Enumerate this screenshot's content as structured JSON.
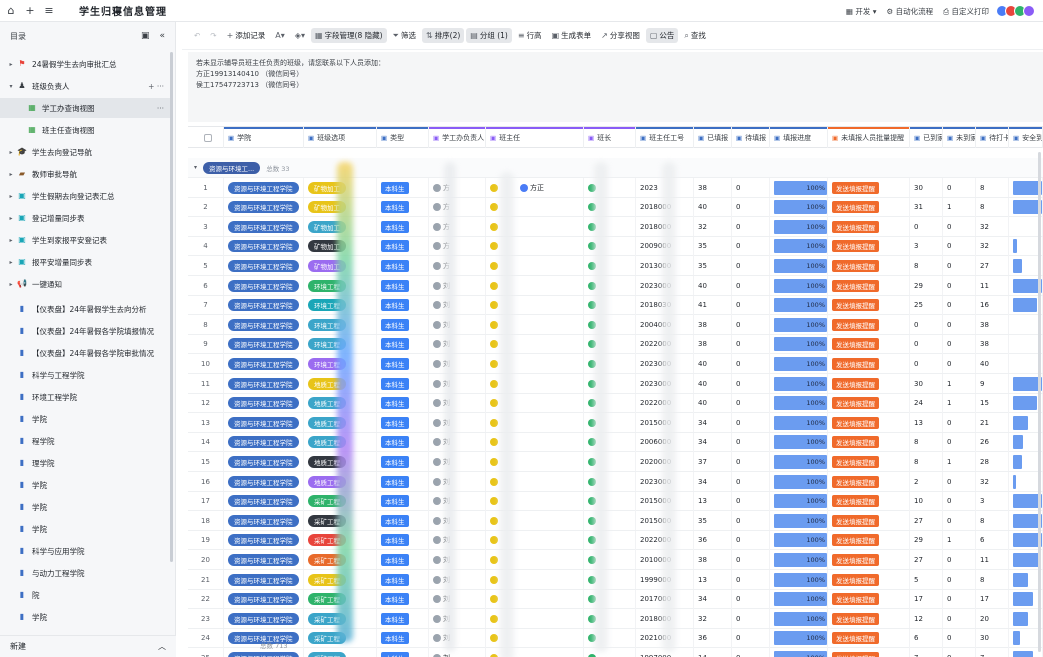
{
  "topbar": {
    "title": "学生归寝信息管理",
    "right_items": [
      "开发",
      "自动化流程",
      "自定义打印"
    ]
  },
  "sidebar": {
    "heading": "目录",
    "footer_new": "新建",
    "items": [
      {
        "label": "24暑假学生去向审批汇总",
        "icon": "flag-icon",
        "icon_color": "#e8453c",
        "arrow": "right"
      },
      {
        "label": "班级负责人",
        "icon": "person-icon",
        "icon_color": "#3a3f45",
        "arrow": "down"
      },
      {
        "label": "学工办查询视图",
        "icon": "table-icon",
        "icon_color": "#2e9c3f",
        "arrow": "",
        "selected": true
      },
      {
        "label": "班主任查询视图",
        "icon": "table-icon",
        "icon_color": "#2e9c3f",
        "arrow": ""
      },
      {
        "label": "学生去向登记导航",
        "icon": "cap-icon",
        "icon_color": "#3a3f45",
        "arrow": "right"
      },
      {
        "label": "教师审批导航",
        "icon": "briefcase-icon",
        "icon_color": "#8a5a2b",
        "arrow": "right"
      },
      {
        "label": "学生假期去向登记表汇总",
        "icon": "form-icon",
        "icon_color": "#1aa6b7",
        "arrow": "right"
      },
      {
        "label": "登记增量同步表",
        "icon": "form-icon",
        "icon_color": "#1aa6b7",
        "arrow": "right"
      },
      {
        "label": "学生到家报平安登记表",
        "icon": "form-icon",
        "icon_color": "#1aa6b7",
        "arrow": "right"
      },
      {
        "label": "报平安增量同步表",
        "icon": "form-icon",
        "icon_color": "#1aa6b7",
        "arrow": "right"
      },
      {
        "label": "一键通知",
        "icon": "megaphone-icon",
        "icon_color": "#e8453c",
        "arrow": "right"
      },
      {
        "label": "【仪表盘】24年暑假学生去向分析",
        "icon": "dashboard-icon",
        "icon_color": "#3d6fc4",
        "arrow": ""
      },
      {
        "label": "【仪表盘】24年暑假各学院填报情况",
        "icon": "dashboard-icon",
        "icon_color": "#3d6fc4",
        "arrow": ""
      },
      {
        "label": "【仪表盘】24年暑假各学院审批情况",
        "icon": "dashboard-icon",
        "icon_color": "#3d6fc4",
        "arrow": ""
      },
      {
        "label": "科学与工程学院",
        "icon": "dashboard-icon",
        "icon_color": "#3d6fc4",
        "arrow": ""
      },
      {
        "label": "环境工程学院",
        "icon": "dashboard-icon",
        "icon_color": "#3d6fc4",
        "arrow": ""
      },
      {
        "label": "学院",
        "icon": "dashboard-icon",
        "icon_color": "#3d6fc4",
        "arrow": ""
      },
      {
        "label": "程学院",
        "icon": "dashboard-icon",
        "icon_color": "#3d6fc4",
        "arrow": ""
      },
      {
        "label": "理学院",
        "icon": "dashboard-icon",
        "icon_color": "#3d6fc4",
        "arrow": ""
      },
      {
        "label": "学院",
        "icon": "dashboard-icon",
        "icon_color": "#3d6fc4",
        "arrow": ""
      },
      {
        "label": "学院",
        "icon": "dashboard-icon",
        "icon_color": "#3d6fc4",
        "arrow": ""
      },
      {
        "label": "学院",
        "icon": "dashboard-icon",
        "icon_color": "#3d6fc4",
        "arrow": ""
      },
      {
        "label": "科学与应用学院",
        "icon": "dashboard-icon",
        "icon_color": "#3d6fc4",
        "arrow": ""
      },
      {
        "label": "与动力工程学院",
        "icon": "dashboard-icon",
        "icon_color": "#3d6fc4",
        "arrow": ""
      },
      {
        "label": "院",
        "icon": "dashboard-icon",
        "icon_color": "#3d6fc4",
        "arrow": ""
      },
      {
        "label": "学院",
        "icon": "dashboard-icon",
        "icon_color": "#3d6fc4",
        "arrow": ""
      }
    ]
  },
  "toolbar": {
    "items": [
      {
        "label": "添加记录",
        "glyph": "+"
      },
      {
        "label": "",
        "glyph": "A▾"
      },
      {
        "label": "",
        "glyph": "◈▾"
      },
      {
        "label": "字段管理(8 隐藏)",
        "glyph": "▦",
        "on": true
      },
      {
        "label": "筛选",
        "glyph": "⏷"
      },
      {
        "label": "排序(2)",
        "glyph": "⇅",
        "on": true
      },
      {
        "label": "分组 (1)",
        "glyph": "▤",
        "on": true
      },
      {
        "label": "行高",
        "glyph": "≡"
      },
      {
        "label": "生成表单",
        "glyph": "▣"
      },
      {
        "label": "分享视图",
        "glyph": "↗"
      },
      {
        "label": "公告",
        "glyph": "▢",
        "on": true
      },
      {
        "label": "查找",
        "glyph": "⌕"
      }
    ]
  },
  "notice": {
    "lines": [
      "若未显示辅导员班主任负责的班级，请您联系以下人员添加：",
      "方正19913140410 （微信同号）",
      "侯工17547723713 （微信同号）"
    ]
  },
  "columns": [
    {
      "label": "学院",
      "color": "#3d6fc4"
    },
    {
      "label": "班级选项",
      "color": "#3d6fc4"
    },
    {
      "label": "类型",
      "color": "#3d6fc4"
    },
    {
      "label": "学工办负责人",
      "color": "#8a5cf6"
    },
    {
      "label": "班主任",
      "color": "#8a5cf6"
    },
    {
      "label": "班长",
      "color": "#8a5cf6"
    },
    {
      "label": "班主任工号",
      "color": "#3d6fc4"
    },
    {
      "label": "已填报",
      "color": "#3d6fc4"
    },
    {
      "label": "待填报",
      "color": "#3d6fc4"
    },
    {
      "label": "填报进度",
      "color": "#3d6fc4"
    },
    {
      "label": "未填报人员批量提醒",
      "color": "#f06a2b"
    },
    {
      "label": "已到家",
      "color": "#3d6fc4"
    },
    {
      "label": "未到家",
      "color": "#3d6fc4"
    },
    {
      "label": "待打卡",
      "color": "#3d6fc4"
    },
    {
      "label": "安全到家",
      "color": "#3d6fc4"
    }
  ],
  "group": {
    "chip": "资源与环境工...",
    "count_label": "总数",
    "count": "33"
  },
  "rows": [
    {
      "n": "1",
      "school": "资源与环境工程学院",
      "cls": "矿物加工",
      "cls_color": "#e8c419",
      "type": "本科生",
      "head": "方",
      "teacher": "方正",
      "no": "2023",
      "filled": "38",
      "pending": "0",
      "progress": "100%",
      "remind": "发送填报提醒",
      "home": "30",
      "away": "0",
      "punch": "8",
      "safe": 0.79
    },
    {
      "n": "2",
      "school": "资源与环境工程学院",
      "cls": "矿物加工",
      "cls_color": "#e8c419",
      "type": "本科生",
      "head": "方",
      "teacher": "",
      "no": "2018000",
      "filled": "40",
      "pending": "0",
      "progress": "100%",
      "remind": "发送填报提醒",
      "home": "31",
      "away": "1",
      "punch": "8",
      "safe": 0.78
    },
    {
      "n": "3",
      "school": "资源与环境工程学院",
      "cls": "矿物加工",
      "cls_color": "#3ba5c9",
      "type": "本科生",
      "head": "方",
      "teacher": "",
      "no": "2018000",
      "filled": "32",
      "pending": "0",
      "progress": "100%",
      "remind": "发送填报提醒",
      "home": "0",
      "away": "0",
      "punch": "32",
      "safe": 0
    },
    {
      "n": "4",
      "school": "资源与环境工程学院",
      "cls": "矿物加工",
      "cls_color": "#333840",
      "type": "本科生",
      "head": "方",
      "teacher": "",
      "no": "2009000",
      "filled": "35",
      "pending": "0",
      "progress": "100%",
      "remind": "发送填报提醒",
      "home": "3",
      "away": "0",
      "punch": "32",
      "safe": 0.09
    },
    {
      "n": "5",
      "school": "资源与环境工程学院",
      "cls": "矿物加工",
      "cls_color": "#9b6cf0",
      "type": "本科生",
      "head": "方",
      "teacher": "",
      "no": "2013000",
      "filled": "35",
      "pending": "0",
      "progress": "100%",
      "remind": "发送填报提醒",
      "home": "8",
      "away": "0",
      "punch": "27",
      "safe": 0.23
    },
    {
      "n": "6",
      "school": "资源与环境工程学院",
      "cls": "环境工程",
      "cls_color": "#2fb36b",
      "type": "本科生",
      "head": "刘",
      "teacher": "",
      "no": "2023000",
      "filled": "40",
      "pending": "0",
      "progress": "100%",
      "remind": "发送填报提醒",
      "home": "29",
      "away": "0",
      "punch": "11",
      "safe": 0.73
    },
    {
      "n": "7",
      "school": "资源与环境工程学院",
      "cls": "环境工程",
      "cls_color": "#1aa6b7",
      "type": "本科生",
      "head": "刘",
      "teacher": "",
      "no": "2018030",
      "filled": "41",
      "pending": "0",
      "progress": "100%",
      "remind": "发送填报提醒",
      "home": "25",
      "away": "0",
      "punch": "16",
      "safe": 0.61
    },
    {
      "n": "8",
      "school": "资源与环境工程学院",
      "cls": "环境工程",
      "cls_color": "#3ba5c9",
      "type": "本科生",
      "head": "刘",
      "teacher": "",
      "no": "2004000",
      "filled": "38",
      "pending": "0",
      "progress": "100%",
      "remind": "发送填报提醒",
      "home": "0",
      "away": "0",
      "punch": "38",
      "safe": 0
    },
    {
      "n": "9",
      "school": "资源与环境工程学院",
      "cls": "环境工程",
      "cls_color": "#3ba5c9",
      "type": "本科生",
      "head": "刘",
      "teacher": "",
      "no": "2022000",
      "filled": "38",
      "pending": "0",
      "progress": "100%",
      "remind": "发送填报提醒",
      "home": "0",
      "away": "0",
      "punch": "38",
      "safe": 0
    },
    {
      "n": "10",
      "school": "资源与环境工程学院",
      "cls": "环境工程",
      "cls_color": "#9b6cf0",
      "type": "本科生",
      "head": "刘",
      "teacher": "",
      "no": "2023000",
      "filled": "40",
      "pending": "0",
      "progress": "100%",
      "remind": "发送填报提醒",
      "home": "0",
      "away": "0",
      "punch": "40",
      "safe": 0
    },
    {
      "n": "11",
      "school": "资源与环境工程学院",
      "cls": "地质工程",
      "cls_color": "#e8c419",
      "type": "本科生",
      "head": "刘",
      "teacher": "",
      "no": "2023000",
      "filled": "40",
      "pending": "0",
      "progress": "100%",
      "remind": "发送填报提醒",
      "home": "30",
      "away": "1",
      "punch": "9",
      "safe": 0.75
    },
    {
      "n": "12",
      "school": "资源与环境工程学院",
      "cls": "地质工程",
      "cls_color": "#3ba5c9",
      "type": "本科生",
      "head": "刘",
      "teacher": "",
      "no": "2022000",
      "filled": "40",
      "pending": "0",
      "progress": "100%",
      "remind": "发送填报提醒",
      "home": "24",
      "away": "1",
      "punch": "15",
      "safe": 0.6
    },
    {
      "n": "13",
      "school": "资源与环境工程学院",
      "cls": "地质工程",
      "cls_color": "#3ba5c9",
      "type": "本科生",
      "head": "刘",
      "teacher": "",
      "no": "2015000",
      "filled": "34",
      "pending": "0",
      "progress": "100%",
      "remind": "发送填报提醒",
      "home": "13",
      "away": "0",
      "punch": "21",
      "safe": 0.38
    },
    {
      "n": "14",
      "school": "资源与环境工程学院",
      "cls": "地质工程",
      "cls_color": "#3ba5c9",
      "type": "本科生",
      "head": "刘",
      "teacher": "",
      "no": "2006000",
      "filled": "34",
      "pending": "0",
      "progress": "100%",
      "remind": "发送填报提醒",
      "home": "8",
      "away": "0",
      "punch": "26",
      "safe": 0.24
    },
    {
      "n": "15",
      "school": "资源与环境工程学院",
      "cls": "地质工程",
      "cls_color": "#333840",
      "type": "本科生",
      "head": "刘",
      "teacher": "",
      "no": "2020000",
      "filled": "37",
      "pending": "0",
      "progress": "100%",
      "remind": "发送填报提醒",
      "home": "8",
      "away": "1",
      "punch": "28",
      "safe": 0.22
    },
    {
      "n": "16",
      "school": "资源与环境工程学院",
      "cls": "地质工程",
      "cls_color": "#9b6cf0",
      "type": "本科生",
      "head": "刘",
      "teacher": "",
      "no": "2023000",
      "filled": "34",
      "pending": "0",
      "progress": "100%",
      "remind": "发送填报提醒",
      "home": "2",
      "away": "0",
      "punch": "32",
      "safe": 0.06
    },
    {
      "n": "17",
      "school": "资源与环境工程学院",
      "cls": "采矿工程",
      "cls_color": "#2fb36b",
      "type": "本科生",
      "head": "刘",
      "teacher": "",
      "no": "2015000",
      "filled": "13",
      "pending": "0",
      "progress": "100%",
      "remind": "发送填报提醒",
      "home": "10",
      "away": "0",
      "punch": "3",
      "safe": 0.77
    },
    {
      "n": "18",
      "school": "资源与环境工程学院",
      "cls": "采矿工程",
      "cls_color": "#333840",
      "type": "本科生",
      "head": "刘",
      "teacher": "",
      "no": "2015000",
      "filled": "35",
      "pending": "0",
      "progress": "100%",
      "remind": "发送填报提醒",
      "home": "27",
      "away": "0",
      "punch": "8",
      "safe": 0.77
    },
    {
      "n": "19",
      "school": "资源与环境工程学院",
      "cls": "采矿工程",
      "cls_color": "#e8453c",
      "type": "本科生",
      "head": "刘",
      "teacher": "",
      "no": "2022000",
      "filled": "36",
      "pending": "0",
      "progress": "100%",
      "remind": "发送填报提醒",
      "home": "29",
      "away": "1",
      "punch": "6",
      "safe": 0.81
    },
    {
      "n": "20",
      "school": "资源与环境工程学院",
      "cls": "采矿工程",
      "cls_color": "#e86a2b",
      "type": "本科生",
      "head": "刘",
      "teacher": "",
      "no": "2010000",
      "filled": "38",
      "pending": "0",
      "progress": "100%",
      "remind": "发送填报提醒",
      "home": "27",
      "away": "0",
      "punch": "11",
      "safe": 0.71
    },
    {
      "n": "21",
      "school": "资源与环境工程学院",
      "cls": "采矿工程",
      "cls_color": "#e8c419",
      "type": "本科生",
      "head": "刘",
      "teacher": "",
      "no": "1999000",
      "filled": "13",
      "pending": "0",
      "progress": "100%",
      "remind": "发送填报提醒",
      "home": "5",
      "away": "0",
      "punch": "8",
      "safe": 0.38
    },
    {
      "n": "22",
      "school": "资源与环境工程学院",
      "cls": "采矿工程",
      "cls_color": "#2fb36b",
      "type": "本科生",
      "head": "刘",
      "teacher": "",
      "no": "2017000",
      "filled": "34",
      "pending": "0",
      "progress": "100%",
      "remind": "发送填报提醒",
      "home": "17",
      "away": "0",
      "punch": "17",
      "safe": 0.5
    },
    {
      "n": "23",
      "school": "资源与环境工程学院",
      "cls": "采矿工程",
      "cls_color": "#3ba5c9",
      "type": "本科生",
      "head": "刘",
      "teacher": "",
      "no": "2018000",
      "filled": "32",
      "pending": "0",
      "progress": "100%",
      "remind": "发送填报提醒",
      "home": "12",
      "away": "0",
      "punch": "20",
      "safe": 0.38
    },
    {
      "n": "24",
      "school": "资源与环境工程学院",
      "cls": "采矿工程",
      "cls_color": "#3ba5c9",
      "type": "本科生",
      "head": "刘",
      "teacher": "",
      "no": "2021000",
      "filled": "36",
      "pending": "0",
      "progress": "100%",
      "remind": "发送填报提醒",
      "home": "6",
      "away": "0",
      "punch": "30",
      "safe": 0.17
    },
    {
      "n": "25",
      "school": "资源与环境工程学院",
      "cls": "采矿工程",
      "cls_color": "#3ba5c9",
      "type": "本科生",
      "head": "刘",
      "teacher": "",
      "no": "1997000",
      "filled": "14",
      "pending": "0",
      "progress": "100%",
      "remind": "发送填报提醒",
      "home": "7",
      "away": "0",
      "punch": "7",
      "safe": 0.5
    }
  ],
  "footer": {
    "count_label": "总数",
    "count": "713"
  }
}
